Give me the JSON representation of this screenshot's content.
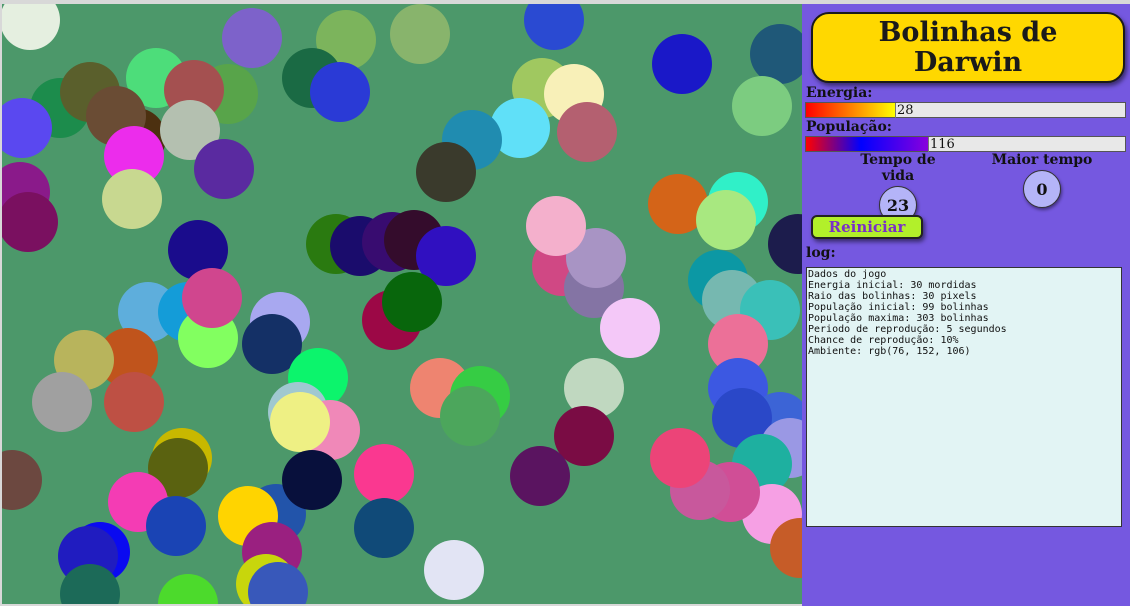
{
  "game": {
    "background": "#4c986a",
    "ball_colors": [
      "#e5efe0",
      "#2a4ad2",
      "#7cb45c",
      "#88b46c",
      "#1a18c8",
      "#1f5878",
      "#1c8c4c",
      "#5a5f2c",
      "#4ddd7a",
      "#1a6a44",
      "#7d62ca",
      "#58a44a",
      "#a45050",
      "#2a3ad6",
      "#5a48f0",
      "#a0c860",
      "#f8f0b8",
      "#60e0f8",
      "#208cb0",
      "#b46070",
      "#7ccc80",
      "#4c3010",
      "#6a4c34",
      "#ec2cec",
      "#b4c0b0",
      "#5a2aa0",
      "#c8d890",
      "#8a1a8a",
      "#7a1060",
      "#3a3a2c",
      "#d46418",
      "#30f0c8",
      "#a8e880",
      "#1c1c4c",
      "#1a0c8c",
      "#2a7a10",
      "#1a0c6c",
      "#380c70",
      "#340c2c",
      "#3010c0",
      "#d04884",
      "#8474a4",
      "#a894c4",
      "#f4b0cc",
      "#f4c8f8",
      "#0c98a4",
      "#76b8b0",
      "#3ac0b8",
      "#ec7098",
      "#5eaedc",
      "#149cd8",
      "#82ff60",
      "#d0468e",
      "#a8a8f0",
      "#143066",
      "#9c0846",
      "#08660c",
      "#c0541c",
      "#b8b45c",
      "#be5044",
      "#a0a0a0",
      "#0cf46c",
      "#a0c8d0",
      "#f088b8",
      "#ee8470",
      "#36cc44",
      "#4ca65c",
      "#eef084",
      "#c0d8c0",
      "#3c58e2",
      "#3c64d6",
      "#2a48c8",
      "#9a98e4",
      "#1eb0a0",
      "#f6a0e4",
      "#c65c28",
      "#d04e96",
      "#c8589c",
      "#6c4840",
      "#c8b800",
      "#5a6210",
      "#f43cb4",
      "#1a44b4",
      "#2254aa",
      "#ffd400",
      "#9a2080",
      "#08103c",
      "#fa3890",
      "#104a78",
      "#7a0c44",
      "#ec4478",
      "#5a1460",
      "#e2e4f4",
      "#0a0af0",
      "#201cc0",
      "#4cda2c",
      "#c8d60c",
      "#3858ba",
      "#1c6a58"
    ]
  },
  "panel": {
    "title": "Bolinhas de Darwin",
    "energy_label": "Energia:",
    "energy_value": "28",
    "energy_fraction": 0.28,
    "population_label": "População:",
    "population_value": "116",
    "population_fraction": 0.383,
    "lifetime_label": "Tempo de vida",
    "lifetime_value": "23",
    "best_time_label": "Maior tempo",
    "best_time_value": "0",
    "restart_label": "Reiniciar",
    "log_label": "log:",
    "log_lines": [
      "Dados do jogo",
      "Energia inicial: 30 mordidas",
      "Raio das bolinhas: 30 pixels",
      "População inicial: 99 bolinhas",
      "População maxima: 303 bolinhas",
      "Periodo de reprodução: 5 segundos",
      "Chance de reprodução: 10%",
      "Ambiente: rgb(76, 152, 106)"
    ],
    "colors": {
      "panel_bg": "#7558e0",
      "title_bg": "#ffd800",
      "button_bg": "#b2f02a",
      "button_text": "#7a2fc8",
      "log_bg": "#e2f4f4"
    }
  }
}
